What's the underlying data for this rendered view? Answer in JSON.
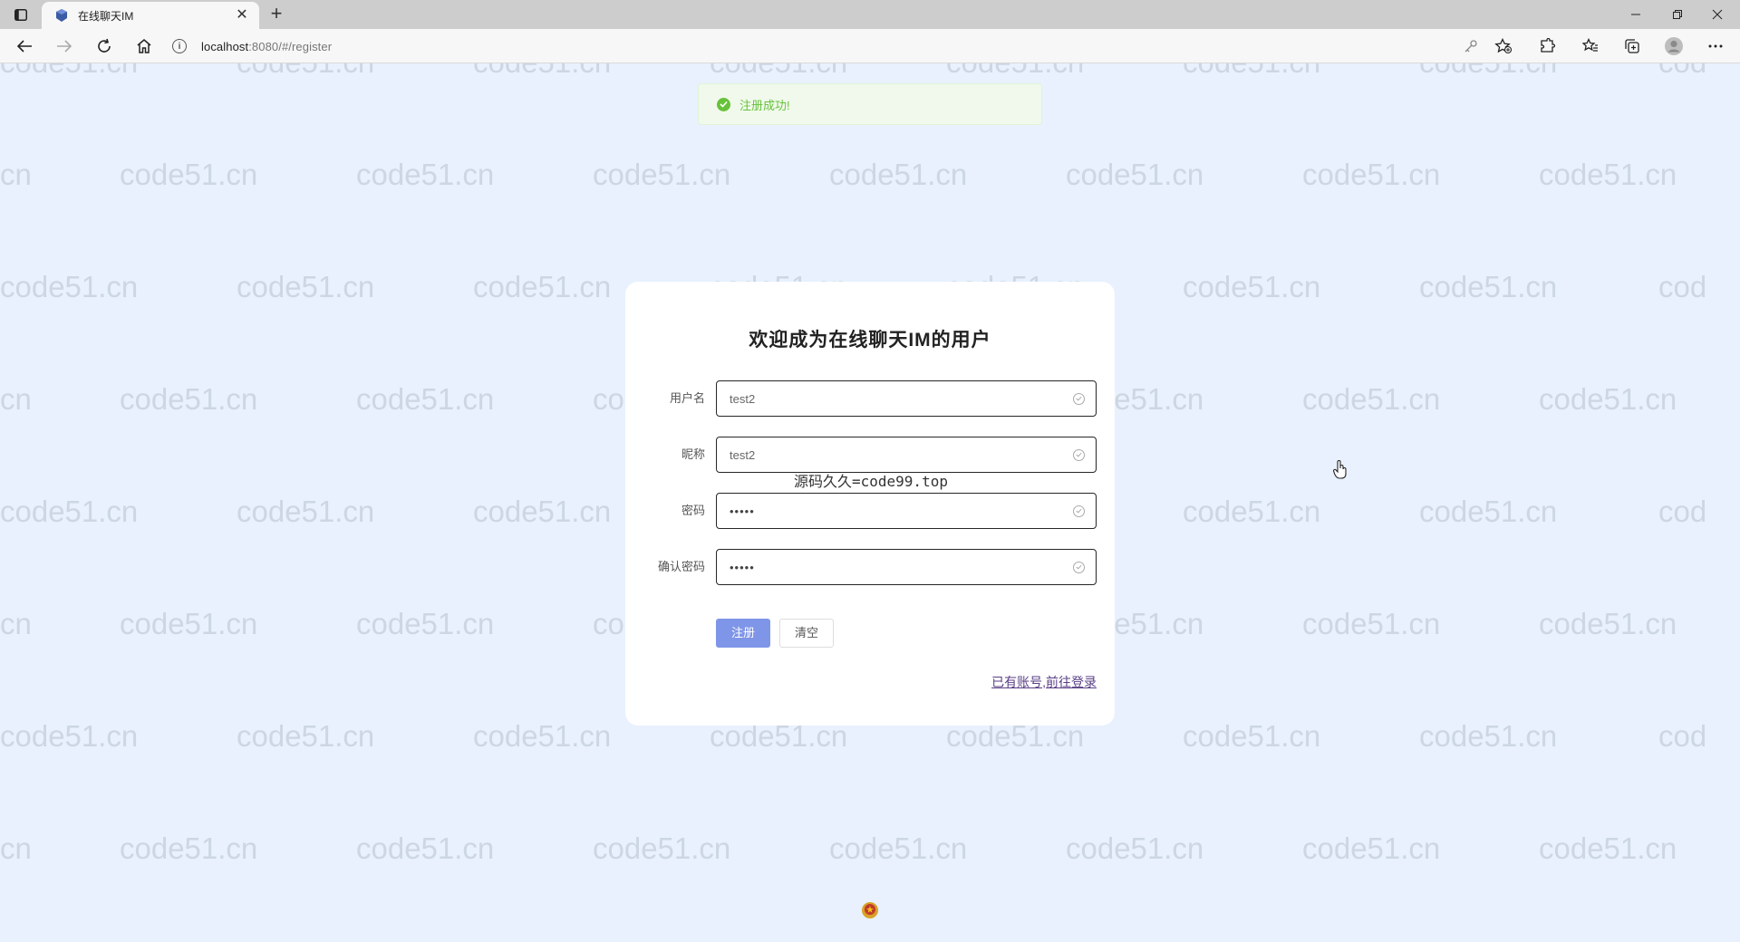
{
  "browser": {
    "tab_title": "在线聊天IM",
    "url_host": "localhost",
    "url_rest": ":8080/#/register",
    "icons": [
      "tab-actions-icon",
      "site-favicon",
      "close-icon",
      "plus-icon",
      "minimize-icon",
      "maximize-icon",
      "close-window-icon",
      "back-icon",
      "forward-icon",
      "refresh-icon",
      "home-icon",
      "info-icon",
      "key-icon",
      "add-favorite-icon",
      "extensions-icon",
      "favorites-icon",
      "collections-icon",
      "profile-icon",
      "more-icon"
    ]
  },
  "watermark": {
    "text": "code51.cn",
    "partial_left": "cn",
    "partial_right": "cod"
  },
  "toast": {
    "message": "注册成功!",
    "color": "#67c23a"
  },
  "form": {
    "title": "欢迎成为在线聊天IM的用户",
    "fields": [
      {
        "label": "用户名",
        "value": "test2"
      },
      {
        "label": "昵称",
        "value": "test2"
      },
      {
        "label": "密码",
        "value": "•••••"
      },
      {
        "label": "确认密码",
        "value": "•••••"
      }
    ],
    "submit_label": "注册",
    "clear_label": "清空",
    "login_link": "已有账号,前往登录",
    "accent_color": "#7f95e8"
  },
  "overlay_text": "源码久久=code99.top"
}
